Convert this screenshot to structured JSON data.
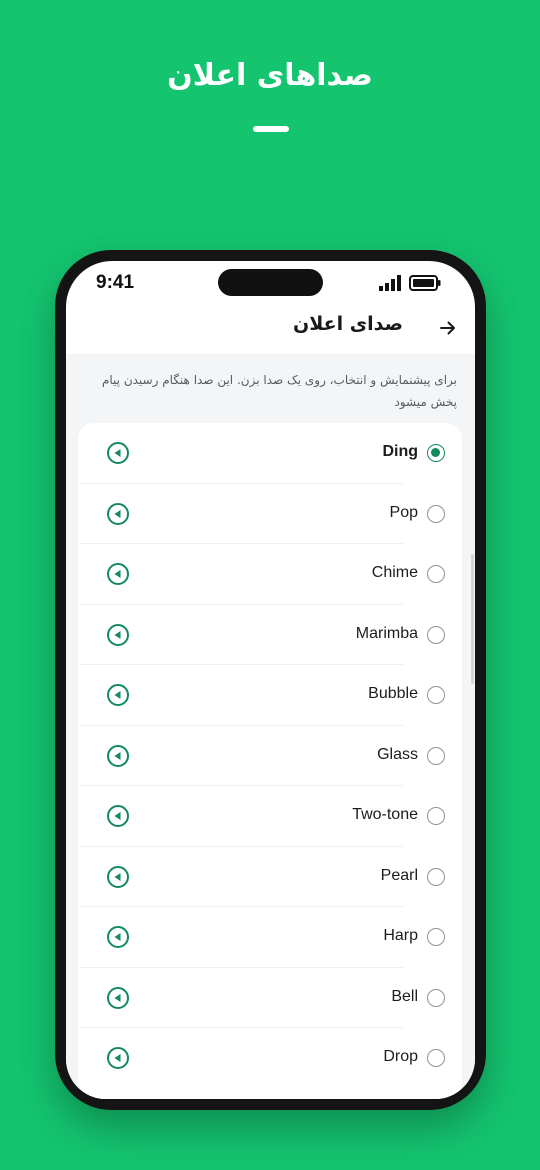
{
  "hero": {
    "title": "صداهای اعلان"
  },
  "status_bar": {
    "time": "9:41"
  },
  "header": {
    "title": "صدای اعلان",
    "back_icon": "arrow-right-icon"
  },
  "description": "برای پیشنمایش و انتخاب، روی یک صدا بزن. این صدا هنگام رسیدن پیام پخش میشود",
  "colors": {
    "background": "#14c46f",
    "accent": "#138a5e"
  },
  "sounds": [
    {
      "name": "Ding",
      "selected": true
    },
    {
      "name": "Pop",
      "selected": false
    },
    {
      "name": "Chime",
      "selected": false
    },
    {
      "name": "Marimba",
      "selected": false
    },
    {
      "name": "Bubble",
      "selected": false
    },
    {
      "name": "Glass",
      "selected": false
    },
    {
      "name": "Two-tone",
      "selected": false
    },
    {
      "name": "Pearl",
      "selected": false
    },
    {
      "name": "Harp",
      "selected": false
    },
    {
      "name": "Bell",
      "selected": false
    },
    {
      "name": "Drop",
      "selected": false
    }
  ]
}
